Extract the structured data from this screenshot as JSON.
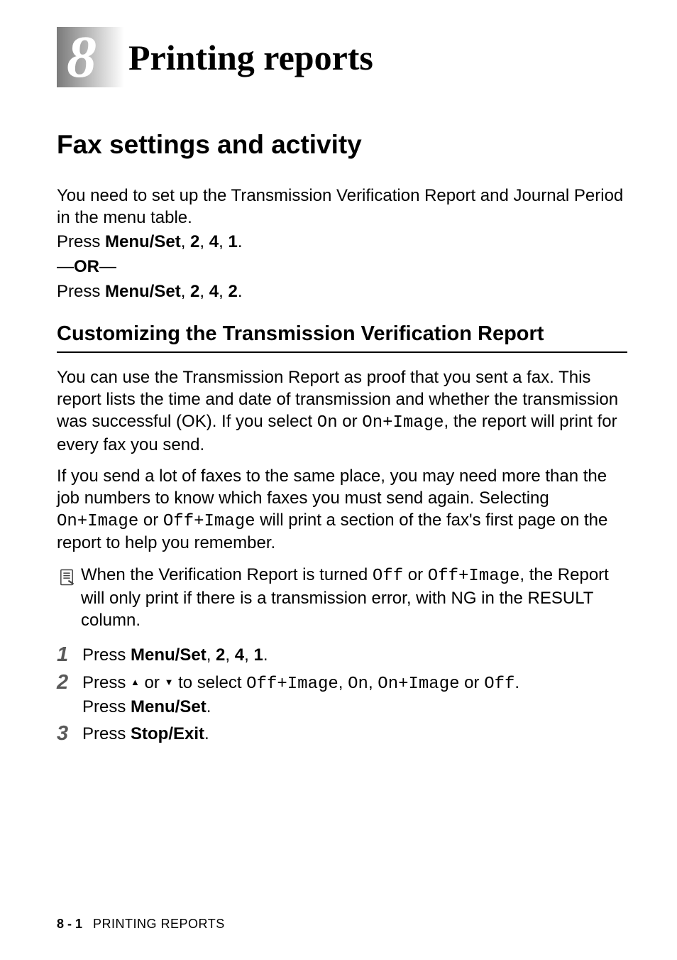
{
  "chapter": {
    "number": "8",
    "title": "Printing reports"
  },
  "section_title": "Fax settings and activity",
  "intro_p1": "You need to set up the Transmission Verification Report and Journal Period in the menu table.",
  "press1_pre": "Press ",
  "press1_bold": "Menu/Set",
  "press1_mid": ", ",
  "press1_k1": "2",
  "press1_k2": "4",
  "press1_k3": "1",
  "press1_end": ".",
  "or_dash1": "—",
  "or_text": "OR",
  "or_dash2": "—",
  "press2_pre": "Press ",
  "press2_bold": "Menu/Set",
  "press2_mid": ", ",
  "press2_k1": "2",
  "press2_k2": "4",
  "press2_k3": "2",
  "press2_end": ".",
  "subsection_title": "Customizing the Transmission Verification Report",
  "para1_a": "You can use the Transmission Report as proof that you sent a fax. This report lists the time and date of transmission and whether the transmission was successful (OK). If you select ",
  "para1_m1": "On",
  "para1_b": " or ",
  "para1_m2": "On+Image",
  "para1_c": ", the report will print for every fax you send.",
  "para2_a": "If you send a lot of faxes to the same place, you may need more than the job numbers to know which faxes you must send again. Selecting ",
  "para2_m1": "On+Image",
  "para2_b": " or ",
  "para2_m2": "Off+Image",
  "para2_c": " will print a section of the fax's first page on the report to help you remember.",
  "note_a": "When the Verification Report is turned ",
  "note_m1": "Off",
  "note_b": " or ",
  "note_m2": "Off+Image",
  "note_c": ", the Report will only print if there is a transmission error, with NG in the RESULT column.",
  "steps": [
    {
      "n": "1",
      "pre": "Press ",
      "b1": "Menu/Set",
      "mid": ", ",
      "k1": "2",
      "k2": "4",
      "k3": "1",
      "end": "."
    }
  ],
  "step2": {
    "n": "2",
    "pre": "Press ",
    "arrow_up": "▲",
    "mid1": " or ",
    "arrow_down": "▼",
    "mid2": " to select ",
    "m1": "Off+Image",
    "c1": ", ",
    "m2": "On",
    "c2": ", ",
    "m3": "On+Image",
    "mid3": " or ",
    "m4": "Off",
    "end1": ".",
    "line2a": "Press ",
    "line2b": "Menu/Set",
    "line2c": "."
  },
  "step3": {
    "n": "3",
    "pre": "Press ",
    "b1": "Stop/Exit",
    "end": "."
  },
  "footer": {
    "page": "8 - 1",
    "section": "PRINTING REPORTS"
  }
}
